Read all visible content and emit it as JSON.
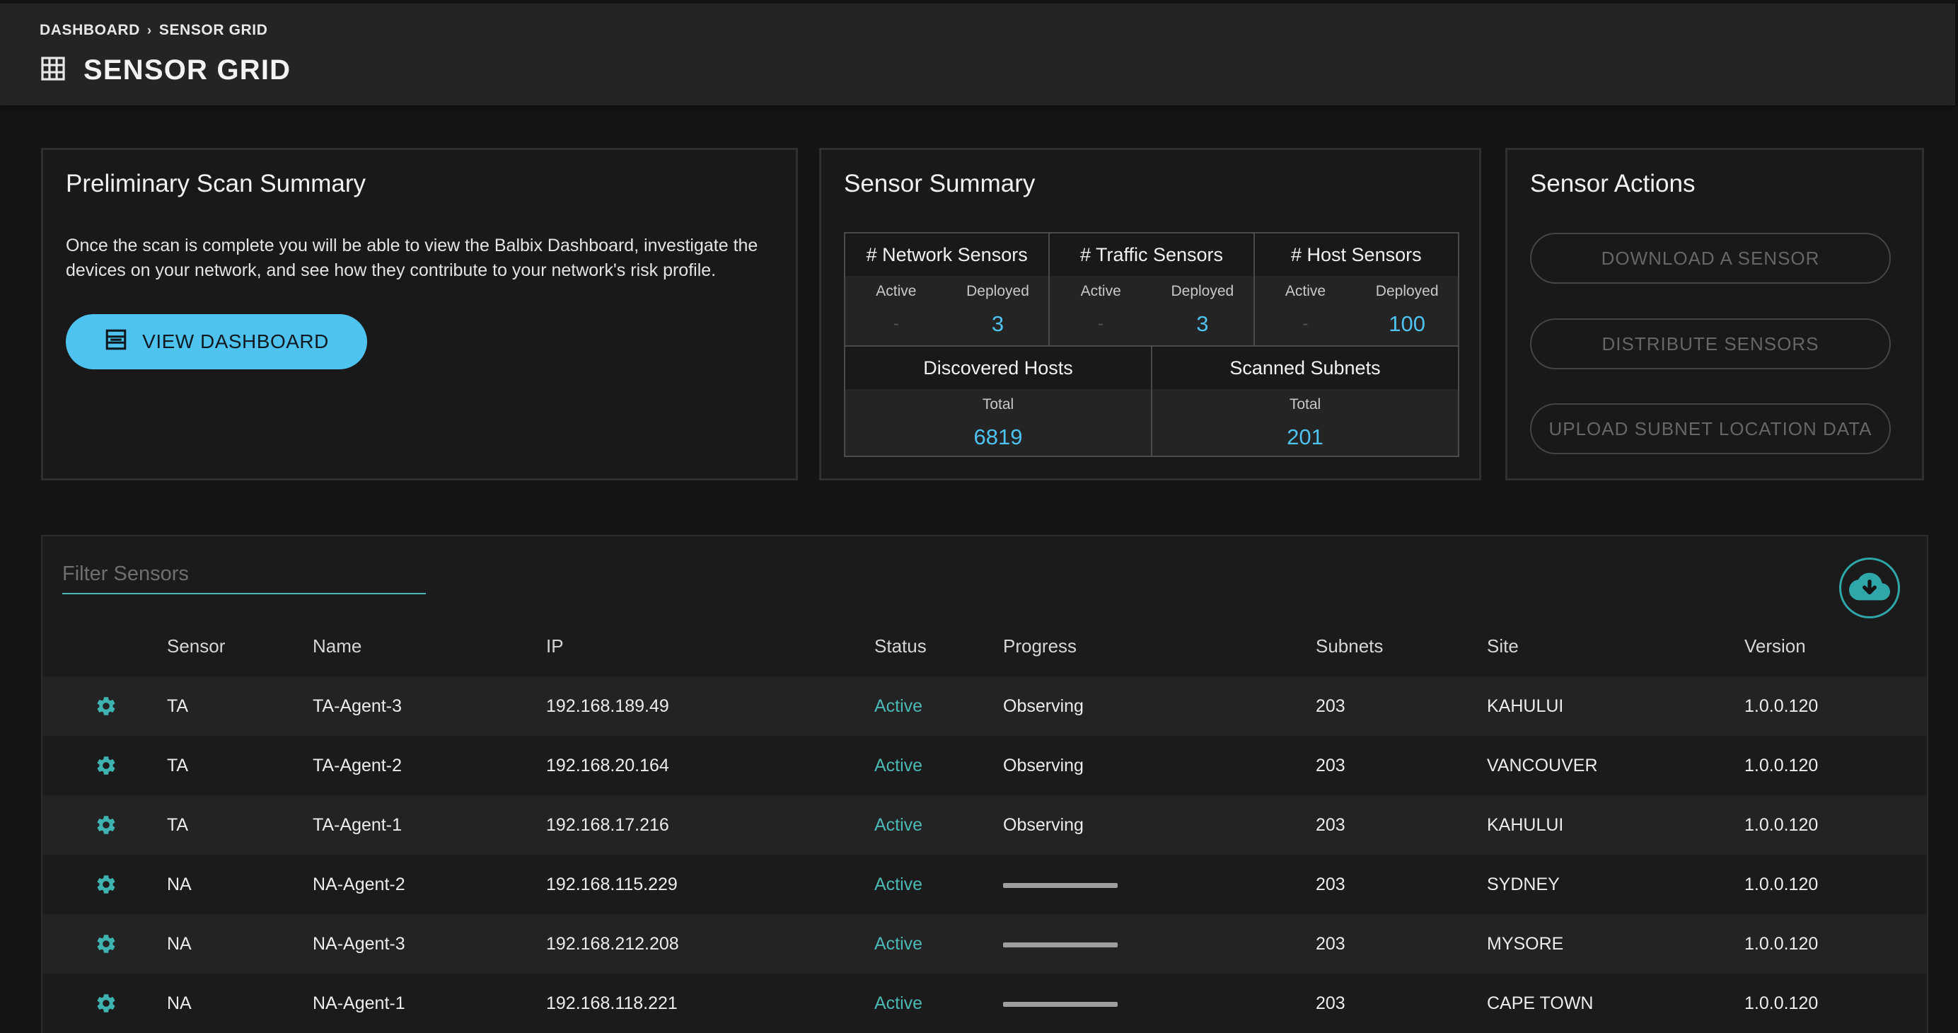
{
  "breadcrumb": {
    "items": [
      "DASHBOARD",
      "SENSOR GRID"
    ],
    "separator": "›"
  },
  "page_title": "SENSOR GRID",
  "prelim": {
    "title": "Preliminary Scan Summary",
    "text": "Once the scan is complete you will be able to view the Balbix Dashboard, investigate the devices on your network, and see how they contribute to your network's risk profile.",
    "button_label": "VIEW DASHBOARD"
  },
  "summary": {
    "title": "Sensor Summary",
    "network": {
      "header": "# Network Sensors",
      "active_label": "Active",
      "active_value": "-",
      "deployed_label": "Deployed",
      "deployed_value": "3"
    },
    "traffic": {
      "header": "# Traffic Sensors",
      "active_label": "Active",
      "active_value": "-",
      "deployed_label": "Deployed",
      "deployed_value": "3"
    },
    "host": {
      "header": "# Host Sensors",
      "active_label": "Active",
      "active_value": "-",
      "deployed_label": "Deployed",
      "deployed_value": "100"
    },
    "hosts": {
      "header": "Discovered Hosts",
      "total_label": "Total",
      "total_value": "6819"
    },
    "subnets": {
      "header": "Scanned Subnets",
      "total_label": "Total",
      "total_value": "201"
    }
  },
  "actions": {
    "title": "Sensor Actions",
    "download": "DOWNLOAD A SENSOR",
    "distribute": "DISTRIBUTE SENSORS",
    "upload": "UPLOAD SUBNET LOCATION DATA"
  },
  "filter": {
    "placeholder": "Filter Sensors"
  },
  "table": {
    "headers": {
      "sensor": "Sensor",
      "name": "Name",
      "ip": "IP",
      "status": "Status",
      "progress": "Progress",
      "subnets": "Subnets",
      "site": "Site",
      "version": "Version"
    },
    "rows": [
      {
        "sensor": "TA",
        "name": "TA-Agent-3",
        "ip": "192.168.189.49",
        "status": "Active",
        "progress": "Observing",
        "subnets": "203",
        "site": "KAHULUI",
        "version": "1.0.0.120"
      },
      {
        "sensor": "TA",
        "name": "TA-Agent-2",
        "ip": "192.168.20.164",
        "status": "Active",
        "progress": "Observing",
        "subnets": "203",
        "site": "VANCOUVER",
        "version": "1.0.0.120"
      },
      {
        "sensor": "TA",
        "name": "TA-Agent-1",
        "ip": "192.168.17.216",
        "status": "Active",
        "progress": "Observing",
        "subnets": "203",
        "site": "KAHULUI",
        "version": "1.0.0.120"
      },
      {
        "sensor": "NA",
        "name": "NA-Agent-2",
        "ip": "192.168.115.229",
        "status": "Active",
        "progress_fraction": 1.0,
        "subnets": "203",
        "site": "SYDNEY",
        "version": "1.0.0.120"
      },
      {
        "sensor": "NA",
        "name": "NA-Agent-3",
        "ip": "192.168.212.208",
        "status": "Active",
        "progress_fraction": 1.0,
        "subnets": "203",
        "site": "MYSORE",
        "version": "1.0.0.120"
      },
      {
        "sensor": "NA",
        "name": "NA-Agent-1",
        "ip": "192.168.118.221",
        "status": "Active",
        "progress_fraction": 1.0,
        "subnets": "203",
        "site": "CAPE TOWN",
        "version": "1.0.0.120"
      }
    ]
  },
  "icons": {
    "title": "grid-icon",
    "dashboard_button": "dashboard-icon",
    "export": "cloud-download-icon",
    "row_action": "gear-icon"
  },
  "colors": {
    "accent": "#4ec3ef",
    "teal": "#4bb8b3",
    "background": "#141414",
    "header": "#242424"
  }
}
